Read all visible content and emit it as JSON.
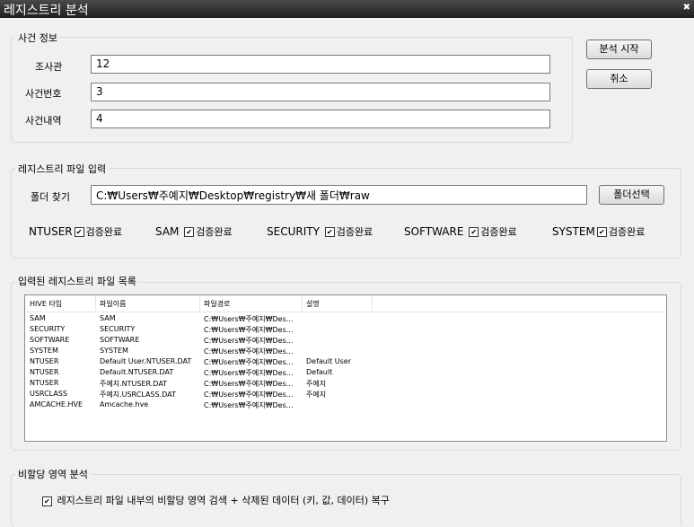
{
  "window": {
    "title": "레지스트리 분석",
    "close_icon": "close-icon"
  },
  "case_info": {
    "legend": "사건 정보",
    "fields": [
      {
        "label": "조사관",
        "value": "12"
      },
      {
        "label": "사건번호",
        "value": "3"
      },
      {
        "label": "사건내역",
        "value": "4"
      }
    ]
  },
  "actions": {
    "start": "분석 시작",
    "cancel": "취소"
  },
  "file_input": {
    "legend": "레지스트리 파일 입력",
    "folder_label": "폴더 찾기",
    "folder_path": "C:₩Users₩주예지₩Desktop₩registry₩새 폴더₩raw",
    "folder_button": "폴더선택",
    "hives": [
      {
        "name": "NTUSER",
        "status": "검증완료",
        "checked": true
      },
      {
        "name": "SAM",
        "status": "검증완료",
        "checked": true
      },
      {
        "name": "SECURITY",
        "status": "검증완료",
        "checked": true
      },
      {
        "name": "SOFTWARE",
        "status": "검증완료",
        "checked": true
      },
      {
        "name": "SYSTEM",
        "status": "검증완료",
        "checked": true
      }
    ]
  },
  "file_list": {
    "legend": "입력된 레지스트리 파일 목록",
    "columns": [
      "HIVE 타입",
      "파일이름",
      "파일경로",
      "설명"
    ],
    "rows": [
      [
        "SAM",
        "SAM",
        "C:₩Users₩주예지₩Des...",
        ""
      ],
      [
        "SECURITY",
        "SECURITY",
        "C:₩Users₩주예지₩Des...",
        ""
      ],
      [
        "SOFTWARE",
        "SOFTWARE",
        "C:₩Users₩주예지₩Des...",
        ""
      ],
      [
        "SYSTEM",
        "SYSTEM",
        "C:₩Users₩주예지₩Des...",
        ""
      ],
      [
        "NTUSER",
        "Default User.NTUSER.DAT",
        "C:₩Users₩주예지₩Des...",
        "Default User"
      ],
      [
        "NTUSER",
        "Default.NTUSER.DAT",
        "C:₩Users₩주예지₩Des...",
        "Default"
      ],
      [
        "NTUSER",
        "주예지.NTUSER.DAT",
        "C:₩Users₩주예지₩Des...",
        "주예지"
      ],
      [
        "USRCLASS",
        "주예지.USRCLASS.DAT",
        "C:₩Users₩주예지₩Des...",
        "주예지"
      ],
      [
        "AMCACHE.HVE",
        "Amcache.hve",
        "C:₩Users₩주예지₩Des...",
        ""
      ]
    ]
  },
  "unalloc": {
    "legend": "비할당 영역 분석",
    "option_label": "레지스트리 파일 내부의 비할당 영역 검색 + 삭제된 데이터 (키, 값, 데이터) 복구",
    "checked": true
  }
}
